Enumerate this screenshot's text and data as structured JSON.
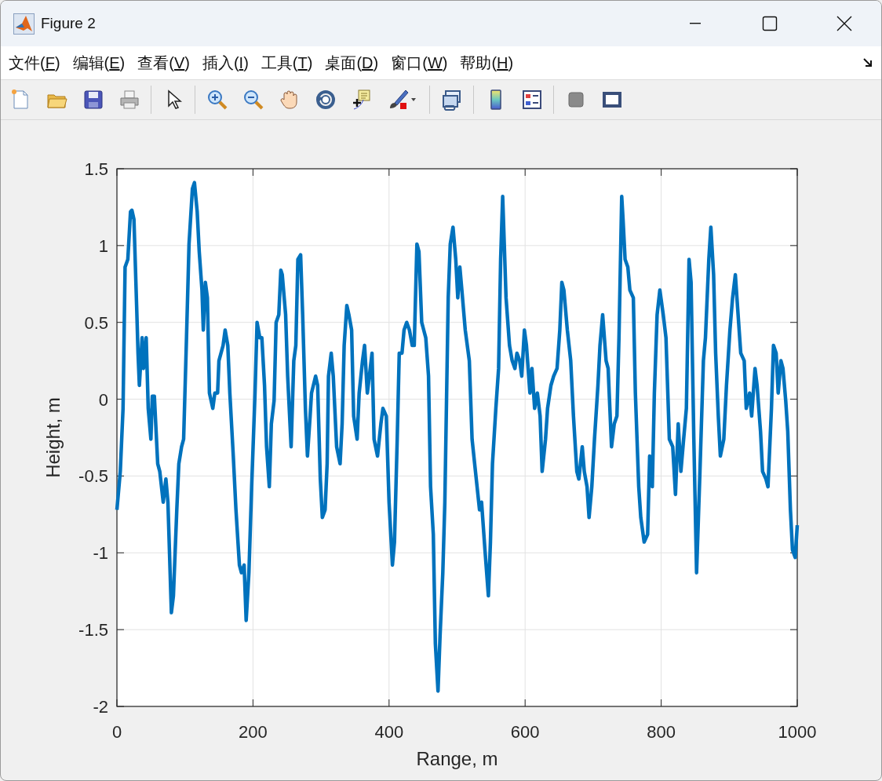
{
  "window": {
    "title": "Figure 2"
  },
  "menu": [
    {
      "before": "文件(",
      "key": "F",
      "after": ")"
    },
    {
      "before": "编辑(",
      "key": "E",
      "after": ")"
    },
    {
      "before": "查看(",
      "key": "V",
      "after": ")"
    },
    {
      "before": "插入(",
      "key": "I",
      "after": ")"
    },
    {
      "before": "工具(",
      "key": "T",
      "after": ")"
    },
    {
      "before": "桌面(",
      "key": "D",
      "after": ")"
    },
    {
      "before": "窗口(",
      "key": "W",
      "after": ")"
    },
    {
      "before": "帮助(",
      "key": "H",
      "after": ")"
    }
  ],
  "toolbar": [
    {
      "kind": "new"
    },
    {
      "kind": "open"
    },
    {
      "kind": "save"
    },
    {
      "kind": "print"
    },
    {
      "kind": "sep"
    },
    {
      "kind": "pointer"
    },
    {
      "kind": "sep"
    },
    {
      "kind": "zoomin"
    },
    {
      "kind": "zoomout"
    },
    {
      "kind": "pan"
    },
    {
      "kind": "rotate"
    },
    {
      "kind": "cursor"
    },
    {
      "kind": "brush"
    },
    {
      "kind": "sep"
    },
    {
      "kind": "link"
    },
    {
      "kind": "sep"
    },
    {
      "kind": "colorbar"
    },
    {
      "kind": "legend"
    },
    {
      "kind": "sep"
    },
    {
      "kind": "square"
    },
    {
      "kind": "frame"
    }
  ],
  "figure": {
    "chart_data": {
      "type": "line",
      "grid": true,
      "xlabel": "Range, m",
      "ylabel": "Height, m",
      "xlim": [
        0,
        1000
      ],
      "ylim": [
        -2,
        1.5
      ],
      "xticks": [
        0,
        200,
        400,
        600,
        800,
        1000
      ],
      "yticks": [
        -2,
        -1.5,
        -1,
        -0.5,
        0,
        0.5,
        1,
        1.5
      ],
      "x": [
        0,
        5,
        9,
        12,
        16,
        20,
        22,
        25,
        29,
        31,
        33,
        37,
        39,
        43,
        46,
        50,
        52,
        55,
        60,
        63,
        68,
        72,
        75,
        80,
        83,
        88,
        91,
        95,
        98,
        102,
        106,
        111,
        114,
        118,
        121,
        125,
        127,
        130,
        133,
        136,
        141,
        144,
        148,
        150,
        156,
        159,
        163,
        166,
        171,
        175,
        180,
        183,
        187,
        190,
        194,
        198,
        203,
        206,
        210,
        213,
        217,
        220,
        224,
        227,
        231,
        234,
        238,
        241,
        243,
        248,
        251,
        256,
        260,
        263,
        266,
        270,
        273,
        277,
        280,
        284,
        286,
        292,
        295,
        299,
        302,
        306,
        309,
        311,
        315,
        318,
        323,
        328,
        331,
        334,
        338,
        341,
        345,
        348,
        353,
        356,
        361,
        364,
        368,
        371,
        375,
        378,
        383,
        388,
        391,
        396,
        400,
        405,
        408,
        412,
        415,
        419,
        422,
        426,
        430,
        434,
        437,
        441,
        444,
        448,
        451,
        454,
        458,
        461,
        465,
        468,
        472,
        475,
        479,
        482,
        487,
        490,
        494,
        498,
        501,
        504,
        507,
        512,
        518,
        522,
        527,
        533,
        536,
        541,
        546,
        549,
        552,
        557,
        561,
        564,
        567,
        572,
        577,
        581,
        585,
        588,
        592,
        595,
        599,
        602,
        607,
        610,
        614,
        618,
        622,
        625,
        630,
        633,
        638,
        642,
        647,
        651,
        654,
        657,
        662,
        667,
        671,
        676,
        679,
        684,
        687,
        691,
        694,
        698,
        702,
        707,
        710,
        714,
        719,
        722,
        727,
        731,
        735,
        738,
        742,
        744,
        747,
        751,
        754,
        759,
        762,
        767,
        770,
        775,
        780,
        783,
        787,
        790,
        794,
        798,
        803,
        807,
        812,
        817,
        821,
        825,
        829,
        833,
        837,
        841,
        844,
        848,
        852,
        857,
        862,
        865,
        870,
        873,
        877,
        880,
        884,
        887,
        892,
        896,
        901,
        905,
        909,
        913,
        917,
        922,
        925,
        930,
        933,
        938,
        941,
        946,
        949,
        954,
        957,
        962,
        965,
        969,
        972,
        976,
        979,
        983,
        986,
        990,
        993,
        997,
        1000
      ],
      "values": [
        -0.72,
        -0.47,
        -0.06,
        0.86,
        0.91,
        1.22,
        1.23,
        1.17,
        0.61,
        0.3,
        0.09,
        0.4,
        0.2,
        0.4,
        -0.06,
        -0.26,
        0.02,
        0.02,
        -0.42,
        -0.47,
        -0.67,
        -0.52,
        -0.67,
        -1.39,
        -1.28,
        -0.72,
        -0.42,
        -0.31,
        -0.26,
        0.35,
        1.01,
        1.37,
        1.41,
        1.22,
        0.96,
        0.71,
        0.45,
        0.76,
        0.66,
        0.04,
        -0.06,
        0.04,
        0.04,
        0.25,
        0.35,
        0.45,
        0.35,
        0.04,
        -0.37,
        -0.72,
        -1.08,
        -1.13,
        -1.08,
        -1.44,
        -1.13,
        -0.57,
        0.04,
        0.5,
        0.4,
        0.4,
        0.09,
        -0.31,
        -0.57,
        -0.16,
        -0.01,
        0.5,
        0.55,
        0.84,
        0.81,
        0.55,
        0.15,
        -0.31,
        0.25,
        0.35,
        0.91,
        0.94,
        0.55,
        -0.06,
        -0.37,
        -0.11,
        0.04,
        0.15,
        0.09,
        -0.52,
        -0.77,
        -0.72,
        -0.42,
        0.15,
        0.3,
        0.15,
        -0.31,
        -0.42,
        -0.16,
        0.35,
        0.61,
        0.55,
        0.45,
        -0.11,
        -0.26,
        0.04,
        0.25,
        0.35,
        0.04,
        0.15,
        0.3,
        -0.26,
        -0.37,
        -0.16,
        -0.06,
        -0.11,
        -0.67,
        -1.08,
        -0.93,
        -0.26,
        0.3,
        0.3,
        0.45,
        0.5,
        0.45,
        0.35,
        0.35,
        1.01,
        0.96,
        0.5,
        0.45,
        0.4,
        0.15,
        -0.57,
        -0.88,
        -1.59,
        -1.9,
        -1.54,
        -1.13,
        -0.67,
        0.66,
        1.01,
        1.12,
        0.91,
        0.66,
        0.86,
        0.71,
        0.45,
        0.25,
        -0.26,
        -0.47,
        -0.72,
        -0.67,
        -0.98,
        -1.28,
        -0.93,
        -0.42,
        -0.06,
        0.2,
        0.91,
        1.32,
        0.66,
        0.35,
        0.25,
        0.2,
        0.3,
        0.25,
        0.15,
        0.45,
        0.35,
        0.04,
        0.2,
        -0.06,
        0.04,
        -0.11,
        -0.47,
        -0.26,
        -0.06,
        0.09,
        0.15,
        0.2,
        0.45,
        0.76,
        0.71,
        0.45,
        0.25,
        -0.11,
        -0.47,
        -0.52,
        -0.31,
        -0.47,
        -0.57,
        -0.77,
        -0.57,
        -0.26,
        0.09,
        0.35,
        0.55,
        0.25,
        0.2,
        -0.31,
        -0.16,
        -0.11,
        0.4,
        1.32,
        1.17,
        0.91,
        0.86,
        0.71,
        0.66,
        0.04,
        -0.57,
        -0.77,
        -0.93,
        -0.88,
        -0.37,
        -0.57,
        0.04,
        0.55,
        0.71,
        0.55,
        0.4,
        -0.26,
        -0.31,
        -0.62,
        -0.16,
        -0.47,
        -0.26,
        -0.06,
        0.91,
        0.76,
        -0.26,
        -1.13,
        -0.47,
        0.25,
        0.4,
        0.91,
        1.12,
        0.81,
        0.3,
        -0.11,
        -0.37,
        -0.26,
        0.09,
        0.45,
        0.66,
        0.81,
        0.55,
        0.3,
        0.25,
        -0.06,
        0.04,
        -0.11,
        0.2,
        0.09,
        -0.21,
        -0.47,
        -0.52,
        -0.57,
        -0.06,
        0.35,
        0.3,
        0.04,
        0.25,
        0.2,
        -0.01,
        -0.21,
        -0.72,
        -0.98,
        -1.03,
        -0.82
      ]
    }
  }
}
